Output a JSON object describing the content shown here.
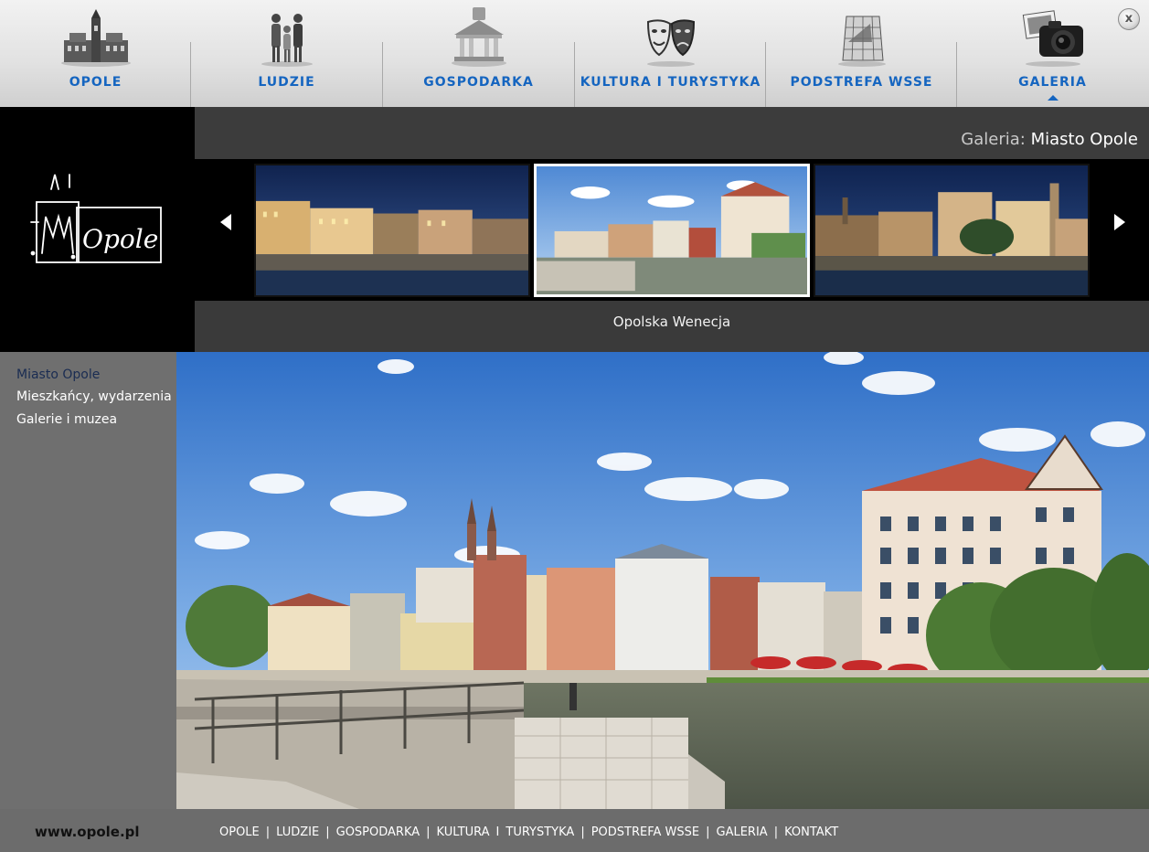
{
  "topnav": {
    "items": [
      {
        "label": "OPOLE",
        "icon": "city-hall-icon"
      },
      {
        "label": "LUDZIE",
        "icon": "people-icon"
      },
      {
        "label": "GOSPODARKA",
        "icon": "bank-building-icon"
      },
      {
        "label": "KULTURA I TURYSTYKA",
        "icon": "theater-masks-icon"
      },
      {
        "label": "PODSTREFA WSSE",
        "icon": "zone-grid-icon"
      },
      {
        "label": "GALERIA",
        "icon": "camera-icon"
      }
    ],
    "active_index": 5,
    "close_label": "x"
  },
  "banner": {
    "gallery_prefix": "Galeria:",
    "gallery_name": "Miasto Opole",
    "logo_text": "Opole",
    "caption": "Opolska Wenecja",
    "active_thumb_index": 1
  },
  "sidebar": {
    "items": [
      {
        "label": "Miasto Opole",
        "active": true
      },
      {
        "label": "Mieszkańcy, wydarzenia",
        "active": false
      },
      {
        "label": "Galerie i muzea",
        "active": false
      }
    ]
  },
  "footer": {
    "site_url": "www.opole.pl",
    "links": [
      "OPOLE",
      "LUDZIE",
      "GOSPODARKA",
      "KULTURA",
      "TURYSTYKA",
      "PODSTREFA WSSE",
      "GALERIA",
      "KONTAKT"
    ],
    "separators": [
      "|",
      "|",
      "|",
      "I",
      "|",
      "|",
      "|"
    ]
  },
  "colors": {
    "nav_label": "#1565c0",
    "sidebar_active": "#1a2c52",
    "banner_bg": "#3a3a3a",
    "sidebar_bg": "#6f6f6f"
  }
}
